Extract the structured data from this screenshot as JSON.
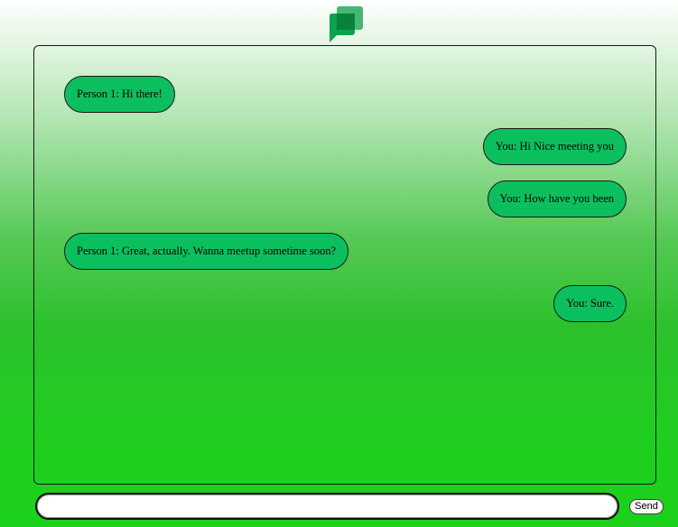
{
  "app": {
    "logo_icon": "google-chat-icon",
    "accent_color": "#0cbf5e"
  },
  "messages": [
    {
      "sender": "other",
      "text": "Person 1: Hi there!"
    },
    {
      "sender": "self",
      "text": "You: Hi Nice meeting you"
    },
    {
      "sender": "self",
      "text": "You: How have you been"
    },
    {
      "sender": "other",
      "text": "Person 1: Great, actually. Wanna meetup sometime soon?"
    },
    {
      "sender": "self",
      "text": "You: Sure."
    }
  ],
  "composer": {
    "value": "",
    "placeholder": "",
    "send_label": "Send"
  }
}
